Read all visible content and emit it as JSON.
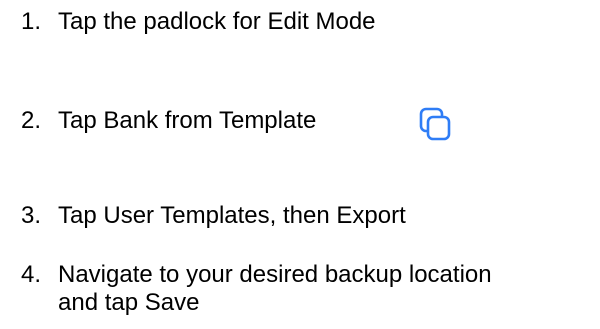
{
  "steps": [
    {
      "number": "1.",
      "text": "Tap the padlock for Edit Mode"
    },
    {
      "number": "2.",
      "text": "Tap Bank from Template"
    },
    {
      "number": "3.",
      "text": "Tap User Templates, then Export"
    },
    {
      "number": "4.",
      "text": "Navigate to your desired backup location\nand tap Save"
    }
  ],
  "icons": {
    "step2": "copy-icon"
  },
  "colors": {
    "text": "#000000",
    "accent": "#2f7df6",
    "background": "#ffffff"
  }
}
